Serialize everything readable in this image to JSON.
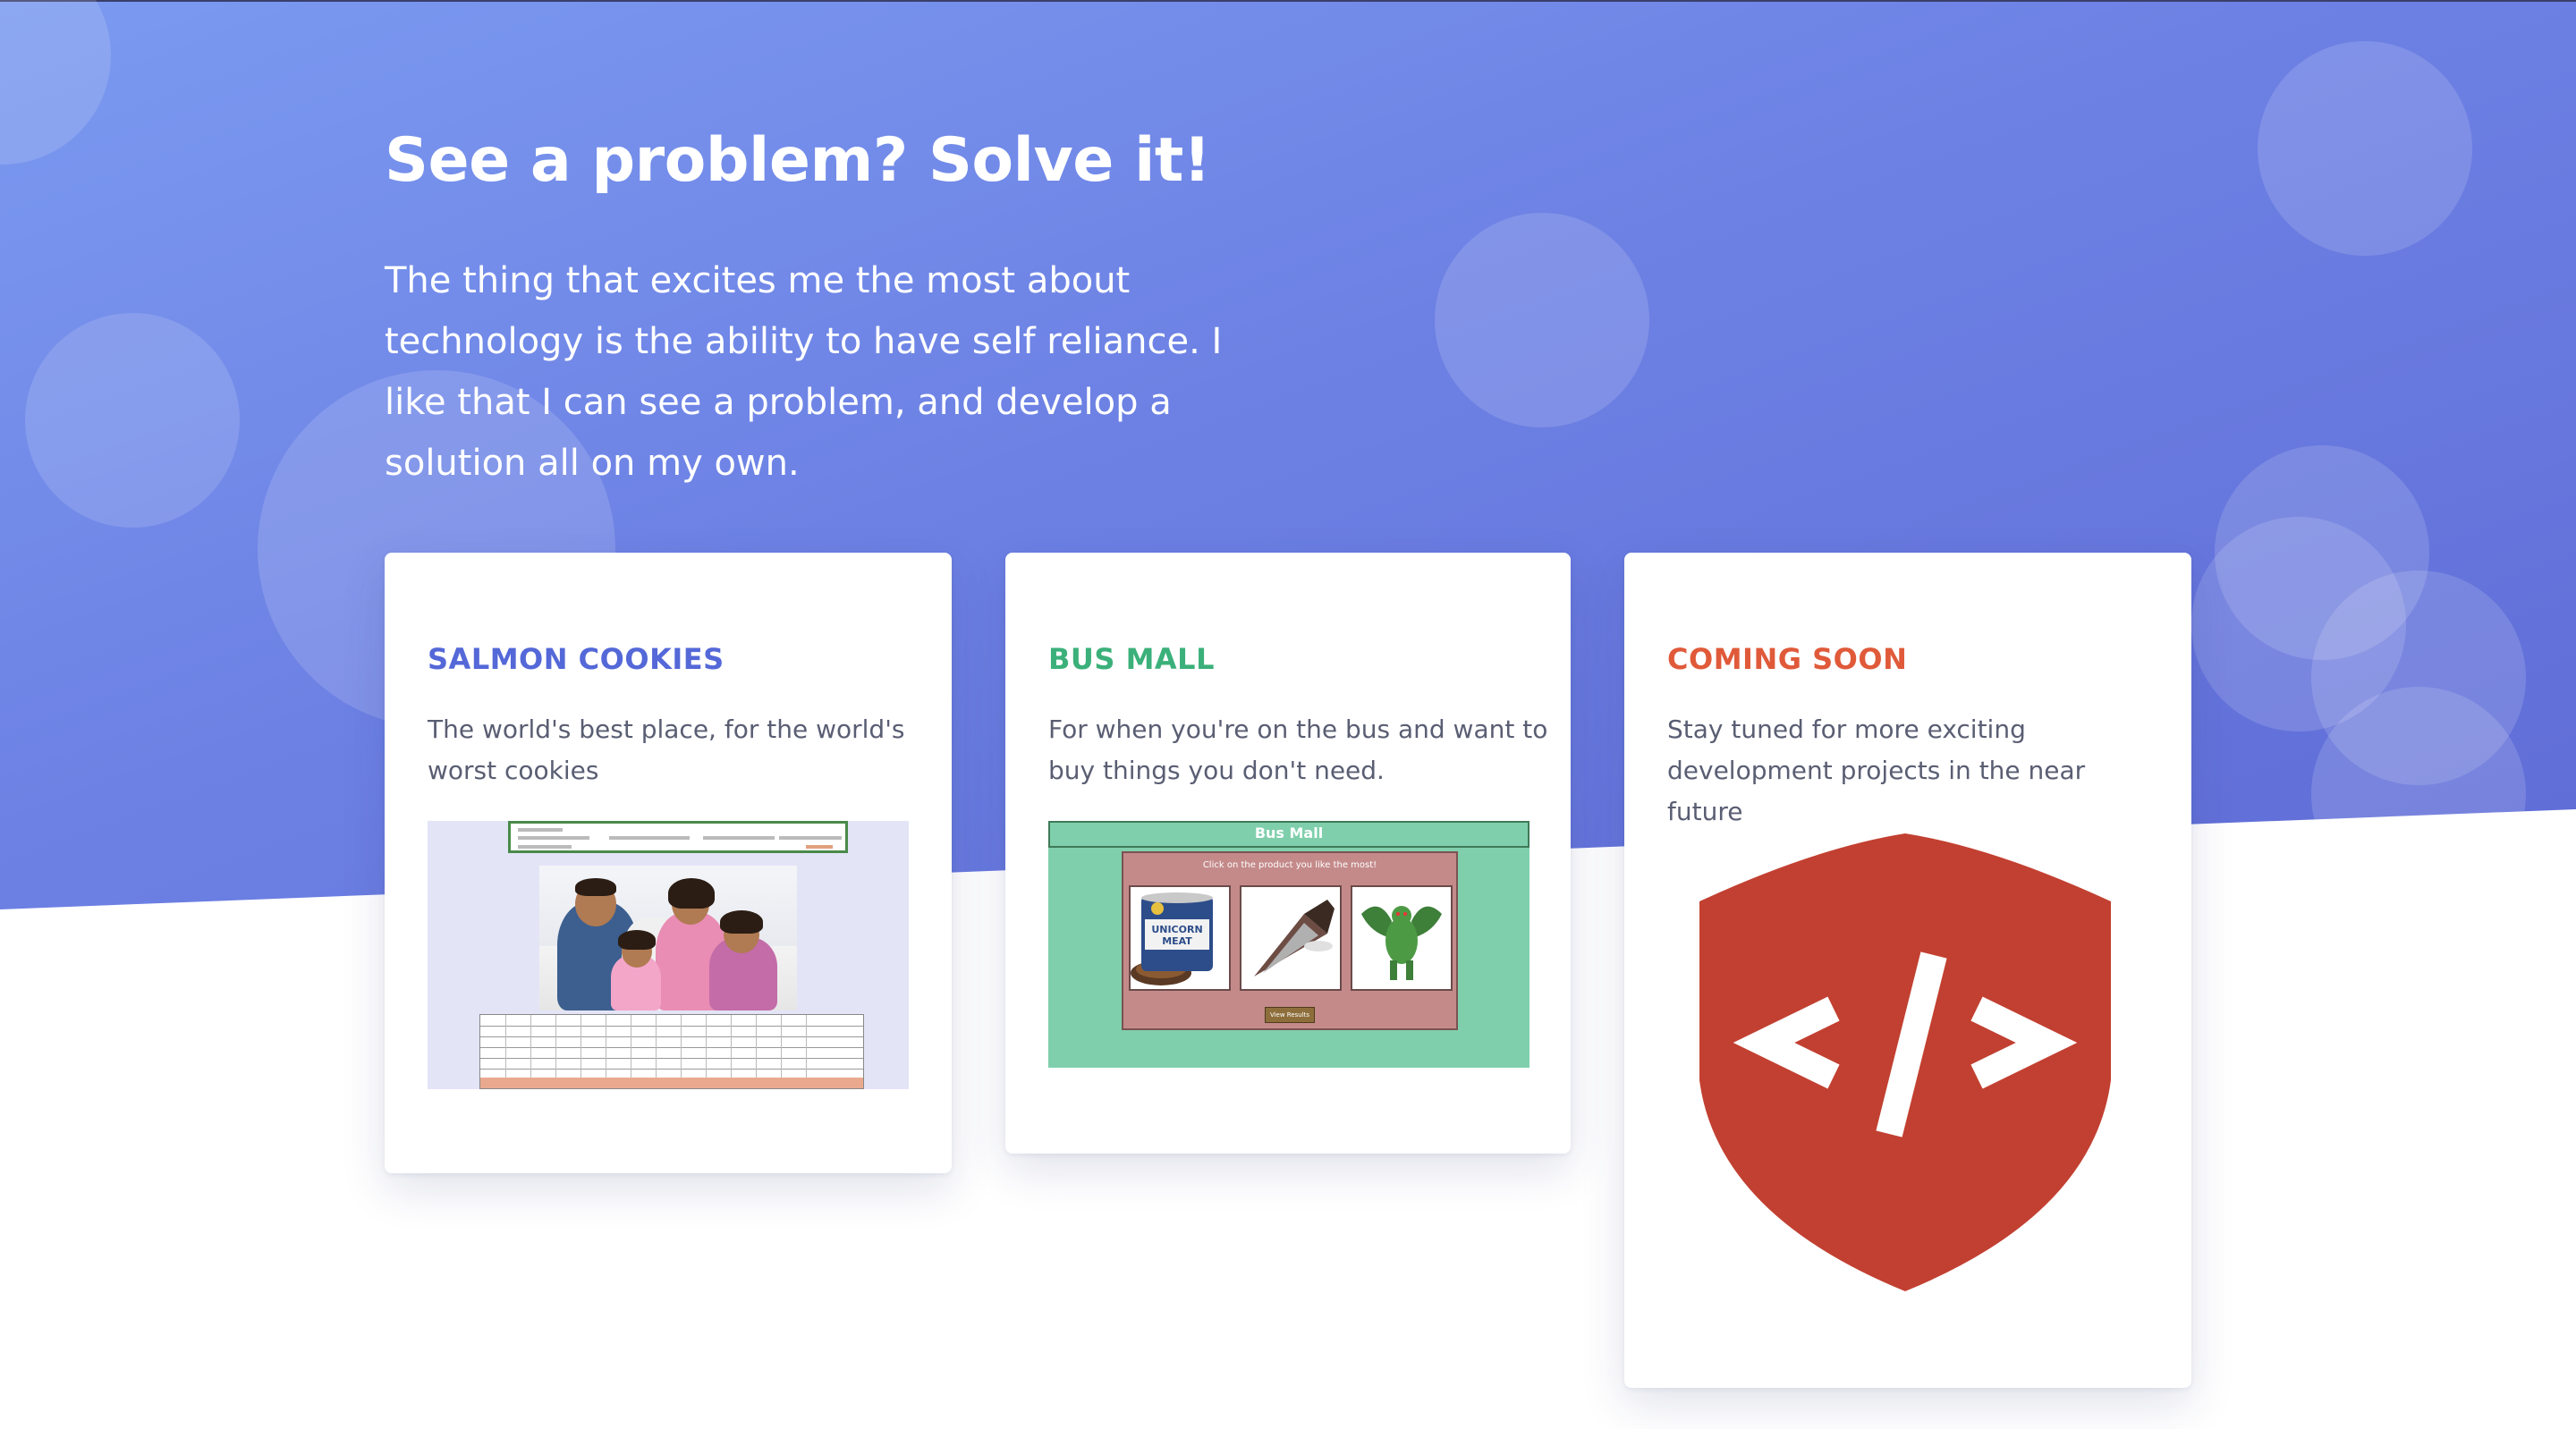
{
  "hero": {
    "headline": "See a problem? Solve it!",
    "intro": "The thing that excites me the most about technology is the ability to have self reliance. I like that I can see a problem, and develop a solution all on my own."
  },
  "colors": {
    "hero_gradient_start": "#7b9af0",
    "hero_gradient_end": "#5f6cd6",
    "salmon_title": "#5468d8",
    "busmall_title": "#3bb07a",
    "coming_title": "#e05a3a",
    "shield": "#c24031"
  },
  "projects": [
    {
      "title": "SALMON COOKIES",
      "description": "The world's best place, for the world's worst cookies",
      "thumbnail": "salmon-cookies-screenshot"
    },
    {
      "title": "BUS MALL",
      "description": "For when you're on the bus and want to buy things you don't need.",
      "thumbnail": "bus-mall-screenshot",
      "screenshot": {
        "header": "Bus Mall",
        "instruction": "Click on the product you like the most!",
        "button": "View Results",
        "product_label": "UNICORN MEAT"
      }
    },
    {
      "title": "COMING SOON",
      "description": "Stay tuned for more exciting development projects in the near future",
      "thumbnail": "code-shield-icon"
    }
  ]
}
